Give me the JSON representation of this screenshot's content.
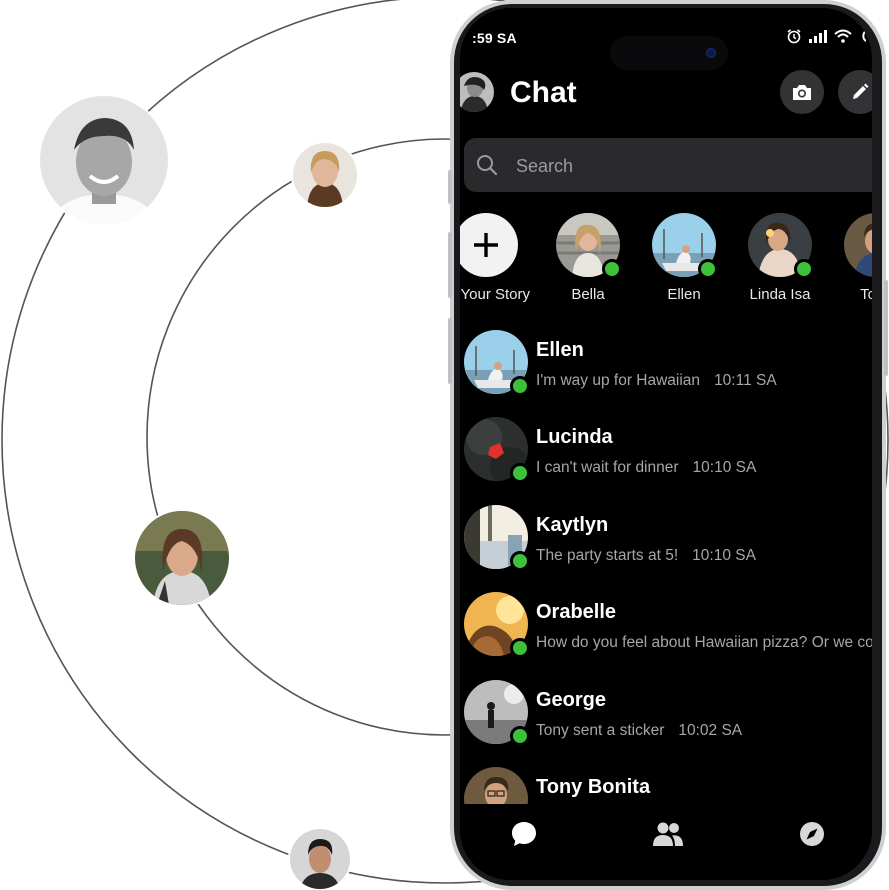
{
  "status_bar": {
    "time": ":59 SA"
  },
  "header": {
    "title": "Chat"
  },
  "search": {
    "placeholder": "Search"
  },
  "stories": [
    {
      "name": "Your Story",
      "type": "add"
    },
    {
      "name": "Bella",
      "online": true
    },
    {
      "name": "Ellen",
      "online": true
    },
    {
      "name": "Linda Isa",
      "online": true
    },
    {
      "name": "Tony",
      "online": false
    }
  ],
  "chats": [
    {
      "name": "Ellen",
      "message": "I'm way up for Hawaiian",
      "time": "10:11 SA",
      "online": true
    },
    {
      "name": "Lucinda",
      "message": "I can't wait for dinner",
      "time": "10:10 SA",
      "online": true
    },
    {
      "name": "Kaytlyn",
      "message": "The party starts at 5!",
      "time": "10:10 SA",
      "online": true
    },
    {
      "name": "Orabelle",
      "message": "How do you feel about Hawaiian pizza? Or we could",
      "time": "",
      "online": true
    },
    {
      "name": "George",
      "message": "Tony sent a sticker",
      "time": "10:02 SA",
      "online": true
    },
    {
      "name": "Tony Bonita",
      "message": "",
      "time": "",
      "online": false
    }
  ],
  "tabbar": {
    "icons": [
      "chat-bubble-icon",
      "people-icon",
      "compass-icon"
    ]
  },
  "colors": {
    "online": "#3ec13a",
    "screen_bg": "#000000",
    "search_bg": "#2a2a2c"
  }
}
